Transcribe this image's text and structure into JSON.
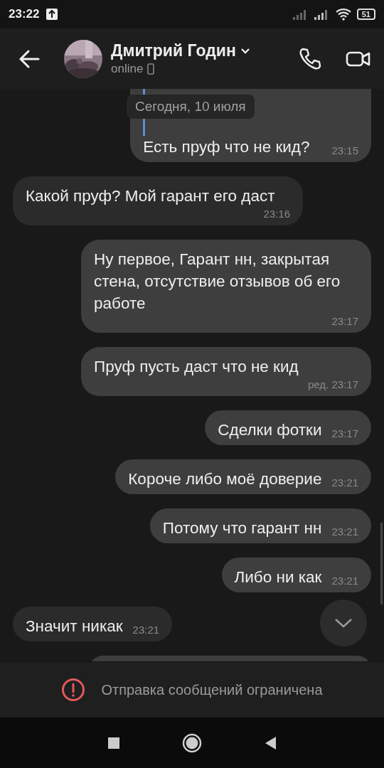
{
  "status_bar": {
    "time": "23:22",
    "battery": "51"
  },
  "header": {
    "name": "Дмитрий Годин",
    "status": "online"
  },
  "date_pill": "Сегодня, 10 июля",
  "messages": [
    {
      "kind": "out",
      "has_reply": true,
      "text": "Есть пруф что не кид?",
      "time": "23:15"
    },
    {
      "kind": "in",
      "has_reply": false,
      "text": "Какой пруф? Мой гарант его даст",
      "time": "23:16"
    },
    {
      "kind": "out",
      "has_reply": false,
      "text": "Ну первое, Гарант нн, закрытая стена, отсутствие отзывов об его работе",
      "time": "23:17"
    },
    {
      "kind": "out",
      "has_reply": false,
      "text": "Пруф пусть даст что не кид",
      "time": "ред. 23:17"
    },
    {
      "kind": "out",
      "has_reply": false,
      "text": "Сделки фотки",
      "time": "23:17"
    },
    {
      "kind": "out",
      "has_reply": false,
      "text": "Короче либо моё доверие",
      "time": "23:21"
    },
    {
      "kind": "out",
      "has_reply": false,
      "text": "Потому что гарант нн",
      "time": "23:21"
    },
    {
      "kind": "out",
      "has_reply": false,
      "text": "Либо ни как",
      "time": "23:21"
    },
    {
      "kind": "in",
      "has_reply": false,
      "text": "Значит никак",
      "time": "23:21"
    },
    {
      "kind": "out-partial"
    }
  ],
  "banner": "Отправка сообщений ограничена"
}
